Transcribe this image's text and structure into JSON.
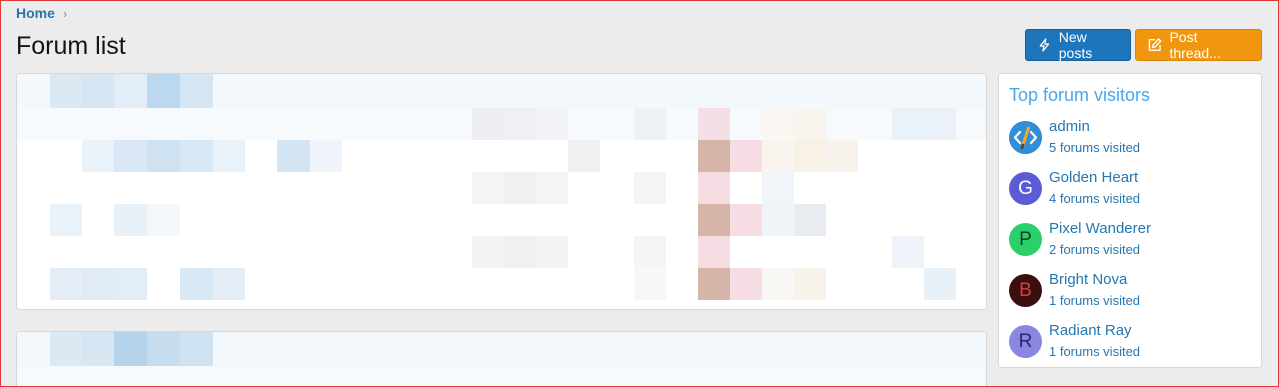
{
  "breadcrumb": {
    "home": "Home",
    "separator": "›"
  },
  "page": {
    "title": "Forum list"
  },
  "actions": {
    "new_posts": {
      "label": "New posts",
      "icon": "bolt-icon"
    },
    "post_thread": {
      "label": "Post thread...",
      "icon": "edit-icon"
    }
  },
  "sidebar": {
    "title": "Top forum visitors",
    "visitors": [
      {
        "name": "admin",
        "count": "5 forums visited",
        "avatar_letter": "",
        "avatar_color": "#2f8fd8"
      },
      {
        "name": "Golden Heart",
        "count": "4 forums visited",
        "avatar_letter": "G",
        "avatar_color": "#5b5bd6"
      },
      {
        "name": "Pixel Wanderer",
        "count": "2 forums visited",
        "avatar_letter": "P",
        "avatar_color": "#2bd06a"
      },
      {
        "name": "Bright Nova",
        "count": "1 forums visited",
        "avatar_letter": "B",
        "avatar_color": "#3a0f10"
      },
      {
        "name": "Radiant Ray",
        "count": "1 forums visited",
        "avatar_letter": "R",
        "avatar_color": "#8b86e0"
      }
    ]
  },
  "colors": {
    "link": "#2577b1",
    "primary_button": "#1d75bb",
    "accent_button": "#f0970f",
    "sidebar_title": "#47a7eb"
  }
}
